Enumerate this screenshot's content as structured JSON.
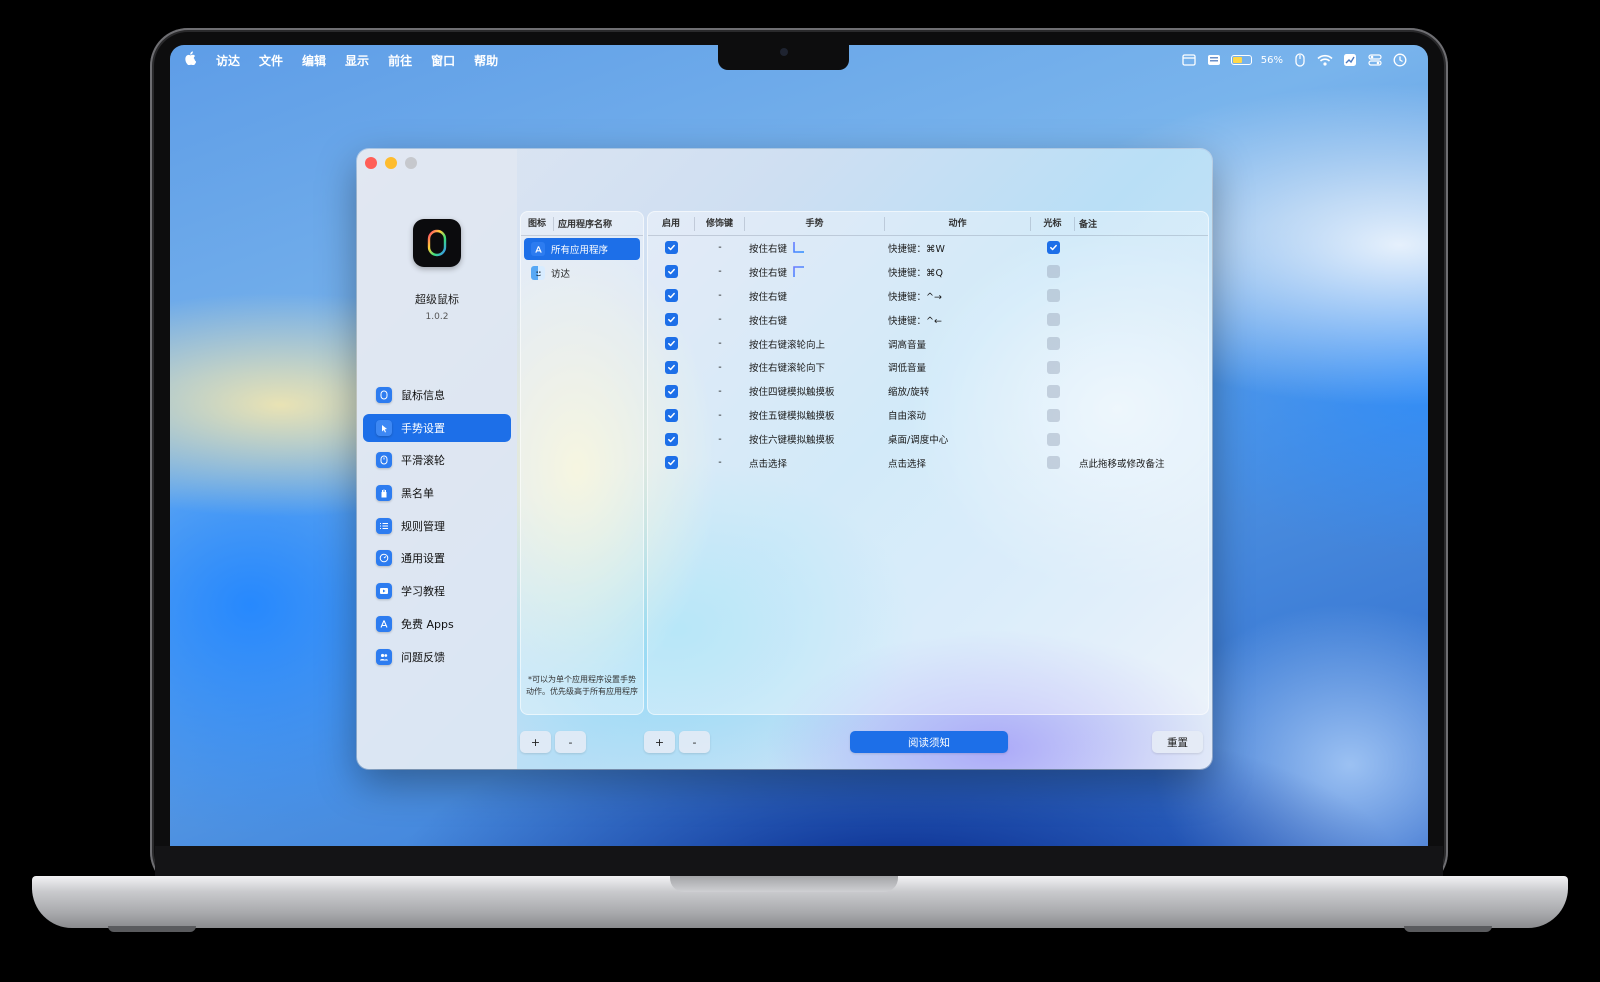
{
  "menubar": {
    "app": "访达",
    "items": [
      "文件",
      "编辑",
      "显示",
      "前往",
      "窗口",
      "帮助"
    ],
    "battery_percent": "56%",
    "battery_level": 0.56
  },
  "sidebar": {
    "app_name": "超级鼠标",
    "version": "1.0.2",
    "items": [
      {
        "label": "鼠标信息",
        "icon": "mouse-icon"
      },
      {
        "label": "手势设置",
        "icon": "cursor-click-icon",
        "active": true
      },
      {
        "label": "平滑滚轮",
        "icon": "scroll-wheel-icon"
      },
      {
        "label": "黑名单",
        "icon": "hand-icon"
      },
      {
        "label": "规则管理",
        "icon": "list-icon"
      },
      {
        "label": "通用设置",
        "icon": "gauge-icon"
      },
      {
        "label": "学习教程",
        "icon": "video-icon"
      },
      {
        "label": "免费 Apps",
        "icon": "app-store-icon"
      },
      {
        "label": "问题反馈",
        "icon": "people-icon"
      }
    ]
  },
  "apps_panel": {
    "headers": {
      "icon": "图标",
      "name": "应用程序名称"
    },
    "items": [
      {
        "name": "所有应用程序",
        "selected": true
      },
      {
        "name": "访达",
        "selected": false
      }
    ],
    "note_line1": "*可以为单个应用程序设置手势",
    "note_line2": "动作。优先级高于所有应用程序",
    "add_label": "+",
    "remove_label": "-"
  },
  "rules_panel": {
    "headers": {
      "enabled": "启用",
      "modifier": "修饰键",
      "gesture": "手势",
      "action": "动作",
      "cursor": "光标",
      "remark": "备注"
    },
    "rows": [
      {
        "enabled": true,
        "modifier": "-",
        "gesture": "按住右键",
        "gesture_shape": "down-right",
        "action": "快捷键：⌘W",
        "cursor": true,
        "remark": ""
      },
      {
        "enabled": true,
        "modifier": "-",
        "gesture": "按住右键",
        "gesture_shape": "up-right",
        "action": "快捷键：⌘Q",
        "cursor": false,
        "remark": ""
      },
      {
        "enabled": true,
        "modifier": "-",
        "gesture": "按住右键",
        "gesture_shape": "left",
        "action": "快捷键：^→",
        "cursor": false,
        "remark": ""
      },
      {
        "enabled": true,
        "modifier": "-",
        "gesture": "按住右键",
        "gesture_shape": "right",
        "action": "快捷键：^←",
        "cursor": false,
        "remark": ""
      },
      {
        "enabled": true,
        "modifier": "-",
        "gesture": "按住右键滚轮向上",
        "gesture_shape": "",
        "action": "调高音量",
        "cursor": false,
        "remark": ""
      },
      {
        "enabled": true,
        "modifier": "-",
        "gesture": "按住右键滚轮向下",
        "gesture_shape": "",
        "action": "调低音量",
        "cursor": false,
        "remark": ""
      },
      {
        "enabled": true,
        "modifier": "-",
        "gesture": "按住四键模拟触摸板",
        "gesture_shape": "",
        "action": "缩放/旋转",
        "cursor": false,
        "remark": ""
      },
      {
        "enabled": true,
        "modifier": "-",
        "gesture": "按住五键模拟触摸板",
        "gesture_shape": "",
        "action": "自由滚动",
        "cursor": false,
        "remark": ""
      },
      {
        "enabled": true,
        "modifier": "-",
        "gesture": "按住六键模拟触摸板",
        "gesture_shape": "",
        "action": "桌面/调度中心",
        "cursor": false,
        "remark": ""
      },
      {
        "enabled": true,
        "modifier": "-",
        "gesture": "点击选择",
        "gesture_shape": "",
        "action": "点击选择",
        "cursor": false,
        "remark": "点此拖移或修改备注"
      }
    ],
    "add_label": "+",
    "remove_label": "-",
    "read_notice_label": "阅读须知",
    "reset_label": "重置"
  },
  "colors": {
    "accent": "#1d6fe8",
    "close": "#ff5f57",
    "minimize": "#febc2e",
    "zoom": "#c6c8cd"
  }
}
